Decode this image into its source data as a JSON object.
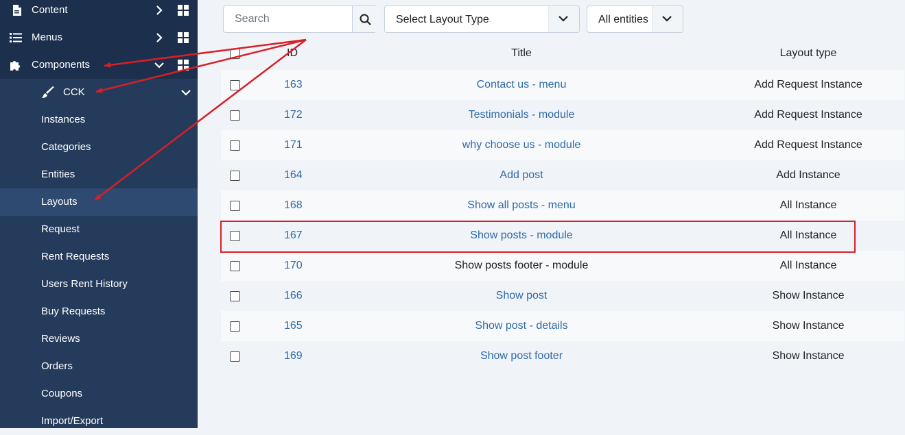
{
  "sidebar": {
    "top_items": [
      {
        "label": "Content",
        "icon": "file-icon"
      },
      {
        "label": "Menus",
        "icon": "list-icon"
      },
      {
        "label": "Components",
        "icon": "puzzle-icon"
      }
    ],
    "cck": {
      "label": "CCK",
      "icon": "brush-icon"
    },
    "sub_items": [
      {
        "label": "Instances"
      },
      {
        "label": "Categories"
      },
      {
        "label": "Entities"
      },
      {
        "label": "Layouts",
        "active": true
      },
      {
        "label": "Request"
      },
      {
        "label": "Rent Requests"
      },
      {
        "label": "Users Rent History"
      },
      {
        "label": "Buy Requests"
      },
      {
        "label": "Reviews"
      },
      {
        "label": "Orders"
      },
      {
        "label": "Coupons"
      },
      {
        "label": "Import/Export"
      }
    ]
  },
  "toolbar": {
    "search_placeholder": "Search",
    "layout_type_select": "Select Layout Type",
    "entities_select": "All entities"
  },
  "table": {
    "columns": [
      "ID",
      "Title",
      "Layout type"
    ],
    "rows": [
      {
        "id": "163",
        "title": "Contact us - menu",
        "type": "Add Request Instance"
      },
      {
        "id": "172",
        "title": "Testimonials - module",
        "type": "Add Request Instance"
      },
      {
        "id": "171",
        "title": "why choose us - module",
        "type": "Add Request Instance"
      },
      {
        "id": "164",
        "title": "Add post",
        "type": "Add Instance"
      },
      {
        "id": "168",
        "title": "Show all posts - menu",
        "type": "All Instance"
      },
      {
        "id": "167",
        "title": "Show posts - module",
        "type": "All Instance"
      },
      {
        "id": "170",
        "title": "Show posts footer - module",
        "type": "All Instance"
      },
      {
        "id": "166",
        "title": "Show post",
        "type": "Show Instance"
      },
      {
        "id": "165",
        "title": "Show post - details",
        "type": "Show Instance"
      },
      {
        "id": "169",
        "title": "Show post footer",
        "type": "Show Instance"
      }
    ]
  },
  "colors": {
    "sidebar_bg": "#1c2f4d",
    "submenu_bg": "#253b5b",
    "active_item_bg": "#2e4a70",
    "link": "#2e6aa6",
    "annotation_red": "#d81f26"
  }
}
